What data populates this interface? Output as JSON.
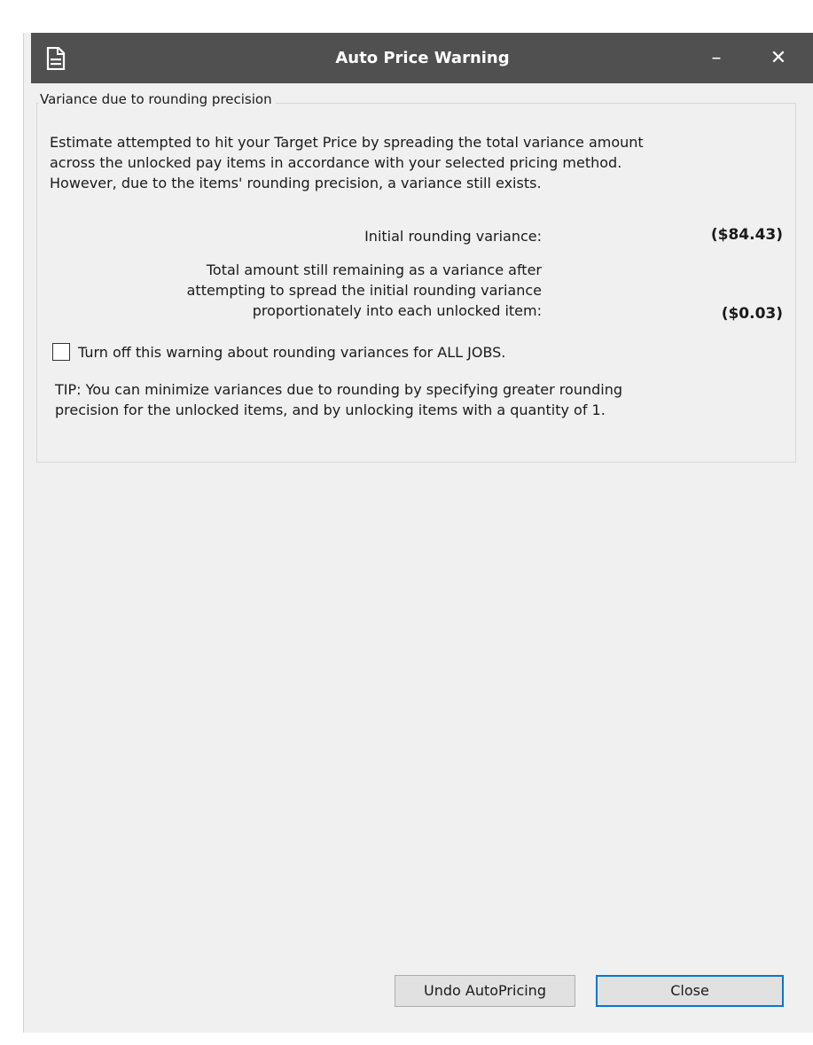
{
  "window": {
    "title": "Auto Price Warning",
    "icon": "document-icon",
    "minimize_glyph": "–",
    "close_glyph": "✕"
  },
  "group": {
    "legend": "Variance due to rounding precision",
    "intro_lines": [
      "Estimate attempted to hit your Target Price by spreading the total variance amount",
      "across the unlocked pay items in accordance with your selected pricing method.",
      "However, due to the items' rounding precision, a variance still exists."
    ],
    "initial_label": "Initial rounding variance:",
    "initial_value": "($84.43)",
    "remaining_label_lines": [
      "Total amount still remaining as a variance after",
      "attempting to spread the initial rounding variance",
      "proportionately into each unlocked item:"
    ],
    "remaining_value": "($0.03)",
    "checkbox_label": "Turn off this warning about rounding variances for ALL JOBS.",
    "checkbox_checked": false,
    "tip_lines": [
      "TIP: You can minimize variances due to rounding by specifying greater rounding",
      "precision for the unlocked items, and by unlocking items with a quantity of 1."
    ]
  },
  "buttons": {
    "undo_label": "Undo AutoPricing",
    "close_label": "Close"
  },
  "colors": {
    "titlebar": "#505050",
    "dialog_bg": "#f0f0f0",
    "focus_border": "#0078d7"
  }
}
